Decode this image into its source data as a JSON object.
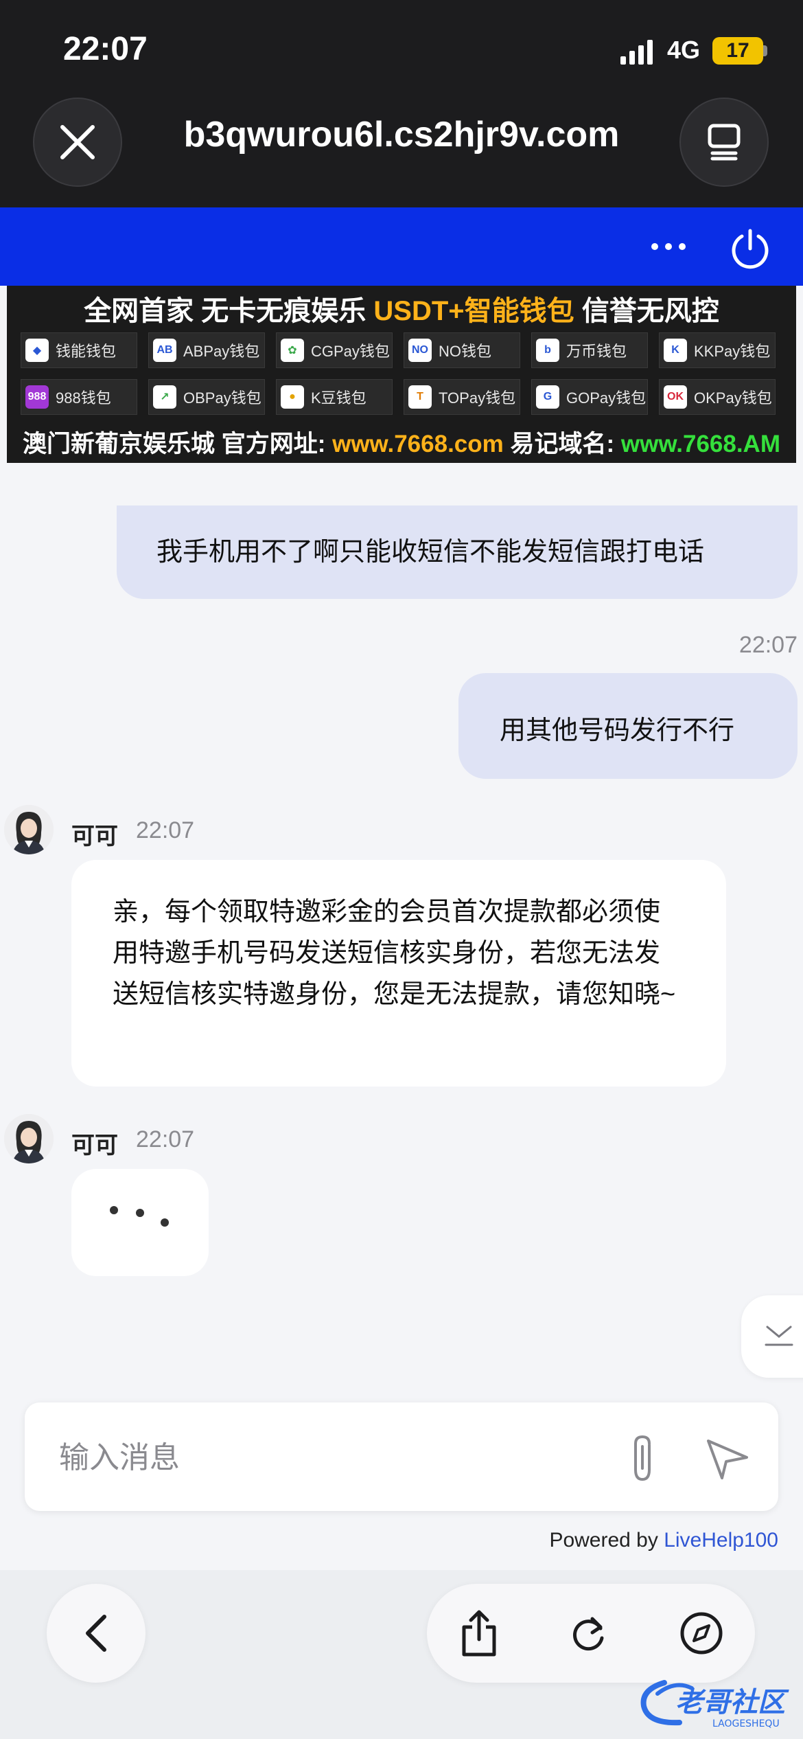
{
  "status_bar": {
    "time": "22:07",
    "network": "4G",
    "battery": "17"
  },
  "browser": {
    "url": "b3qwurou6l.cs2hjr9v.com"
  },
  "banner": {
    "headline_a": "全网首家 无卡无痕娱乐 ",
    "headline_b": "USDT+智能钱包",
    "headline_c": " 信誉无风控",
    "wallets_row1": [
      "钱能钱包",
      "ABPay钱包",
      "CGPay钱包",
      "NO钱包",
      "万币钱包",
      "KKPay钱包"
    ],
    "wallets_row2": [
      "988钱包",
      "OBPay钱包",
      "K豆钱包",
      "TOPay钱包",
      "GOPay钱包",
      "OKPay钱包"
    ],
    "footer_a": "澳门新葡京娱乐城 官方网址: ",
    "footer_url": "www.7668.com",
    "footer_b": " 易记域名: ",
    "footer_domain": "www.7668.AM"
  },
  "messages": {
    "out1": "我手机用不了啊只能收短信不能发短信跟打电话",
    "out_time": "22:07",
    "out2": "用其他号码发行不行",
    "agent_name": "可可",
    "agent_time1": "22:07",
    "agent_msg1": "亲，每个领取特邀彩金的会员首次提款都必须使用特邀手机号码发送短信核实身份，若您无法发送短信核实特邀身份，您是无法提款，请您知晓~",
    "agent_time2": "22:07"
  },
  "composer": {
    "placeholder": "输入消息"
  },
  "footer": {
    "powered_by": "Powered by ",
    "brand": "LiveHelp100"
  },
  "colors": {
    "header_blue": "#0a2ee6",
    "bubble_out": "#dfe3f5",
    "link": "#2f55d4",
    "banner_orange": "#ffb21a",
    "banner_green": "#35e03c"
  },
  "icons": [
    "close-icon",
    "tabs-icon",
    "more-icon",
    "power-icon",
    "attach-icon",
    "send-icon",
    "chevron-down-icon",
    "back-icon",
    "share-icon",
    "reload-icon",
    "compass-icon"
  ]
}
